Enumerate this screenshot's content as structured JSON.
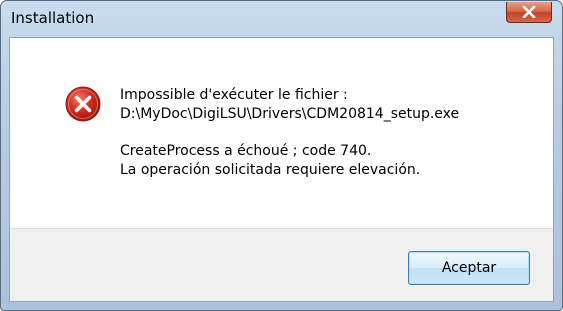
{
  "window": {
    "title": "Installation"
  },
  "dialog": {
    "message_lines": [
      "Impossible d'exécuter le fichier :",
      "D:\\MyDoc\\DigiLSU\\Drivers\\CDM20814_setup.exe",
      "CreateProcess a échoué ; code 740.",
      "La operación solicitada requiere elevación."
    ],
    "icon": "error-icon"
  },
  "buttons": {
    "ok_label": "Aceptar",
    "close_icon": "close-icon"
  },
  "colors": {
    "error_red": "#d42a1f",
    "close_button_red": "#c5422a",
    "title_bar": "#b8cee6"
  }
}
